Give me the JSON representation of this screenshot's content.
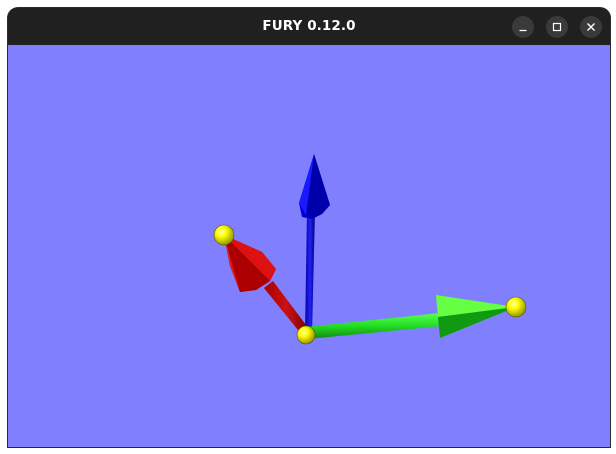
{
  "window": {
    "title": "FURY 0.12.0",
    "controls": {
      "minimize_icon": "minimize-icon",
      "maximize_icon": "maximize-icon",
      "close_icon": "close-icon"
    }
  },
  "scene": {
    "background_color": "#8080ff",
    "arrows": [
      {
        "name": "x-arrow",
        "color": "#00dd00"
      },
      {
        "name": "y-arrow",
        "color": "#0000cc"
      },
      {
        "name": "z-arrow",
        "color": "#cc0000"
      }
    ],
    "spheres_color": "#ffff00"
  }
}
